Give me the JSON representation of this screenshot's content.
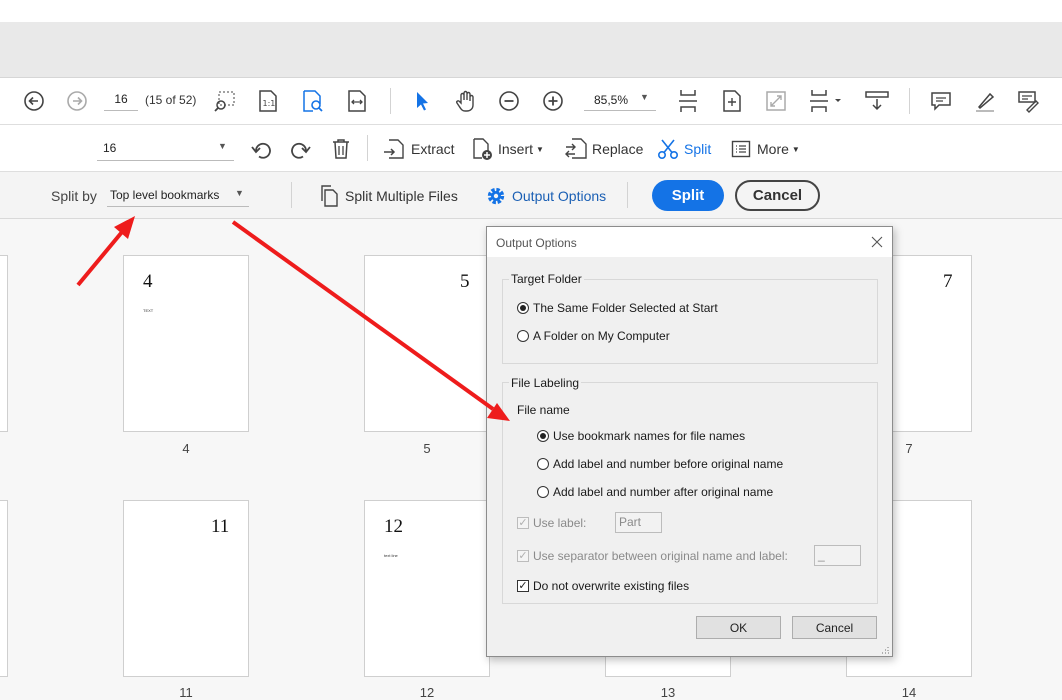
{
  "toolbar": {
    "page_number": "16",
    "page_count": "(15 of 52)",
    "zoom": "85,5%"
  },
  "organize": {
    "page_selector": "16",
    "extract": "Extract",
    "insert": "Insert",
    "replace": "Replace",
    "split": "Split",
    "more": "More"
  },
  "splitbar": {
    "split_by_label": "Split by",
    "split_by_value": "Top level bookmarks",
    "split_multiple": "Split Multiple Files",
    "output_options": "Output Options",
    "split_button": "Split",
    "cancel_button": "Cancel"
  },
  "pages": [
    {
      "label": "4",
      "number": "4",
      "snippet": "TEXT"
    },
    {
      "label": "5",
      "number": "5",
      "snippet": ""
    },
    {
      "label": "7",
      "number": "7",
      "snippet": ""
    },
    {
      "label": "11",
      "number": "11",
      "snippet": ""
    },
    {
      "label": "12",
      "number": "12",
      "snippet": "text line"
    },
    {
      "label": "13",
      "number": "",
      "snippet": ""
    },
    {
      "label": "14",
      "number": "",
      "snippet": ""
    }
  ],
  "dialog": {
    "title": "Output Options",
    "target_folder": {
      "legend": "Target Folder",
      "option_same": "The Same Folder Selected at Start",
      "option_computer": "A Folder on My Computer",
      "selected": "The Same Folder Selected at Start"
    },
    "file_labeling": {
      "legend": "File Labeling",
      "file_name_heading": "File name",
      "option_bookmarks": "Use bookmark names for file names",
      "option_before": "Add label and number before original name",
      "option_after": "Add label and number after original name",
      "selected": "Use bookmark names for file names",
      "use_label": "Use label:",
      "label_value": "Part",
      "use_separator": "Use separator between original name and label:",
      "separator_value": "_",
      "no_overwrite": "Do not overwrite existing files"
    },
    "ok_button": "OK",
    "cancel_button": "Cancel"
  },
  "colors": {
    "accent": "#1473e6",
    "annotation_arrow": "#ee1c1c"
  }
}
